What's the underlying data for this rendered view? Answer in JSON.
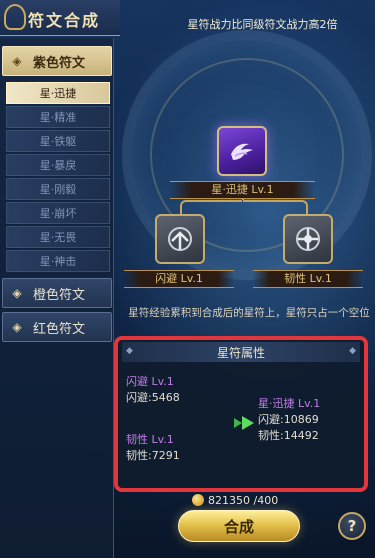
{
  "title": "符文合成",
  "banner": "星符战力比同级符文战力高2倍",
  "sidebar": {
    "categories": [
      {
        "label": "紫色符文",
        "active": true
      },
      {
        "label": "橙色符文",
        "active": false
      },
      {
        "label": "红色符文",
        "active": false
      }
    ],
    "runes": [
      "星·迅捷",
      "星·精准",
      "星·铁躯",
      "星·暴戾",
      "星·刚毅",
      "星·崩坏",
      "星·无畏",
      "星·神击"
    ]
  },
  "main_rune": {
    "name": "星·迅捷 Lv.1"
  },
  "materials": [
    {
      "name": "闪避 Lv.1"
    },
    {
      "name": "韧性 Lv.1"
    }
  ],
  "info": "星符经验累积到合成后的星符上，星符只占一个空位",
  "panel": {
    "title": "星符属性",
    "left": [
      {
        "name": "闪避 Lv.1",
        "stat": "闪避:5468"
      },
      {
        "name": "韧性 Lv.1",
        "stat": "韧性:7291"
      }
    ],
    "right": {
      "name": "星·迅捷 Lv.1",
      "stats": [
        "闪避:10869",
        "韧性:14492"
      ]
    }
  },
  "cost": "821350 /400",
  "compose_label": "合成",
  "help_label": "?"
}
